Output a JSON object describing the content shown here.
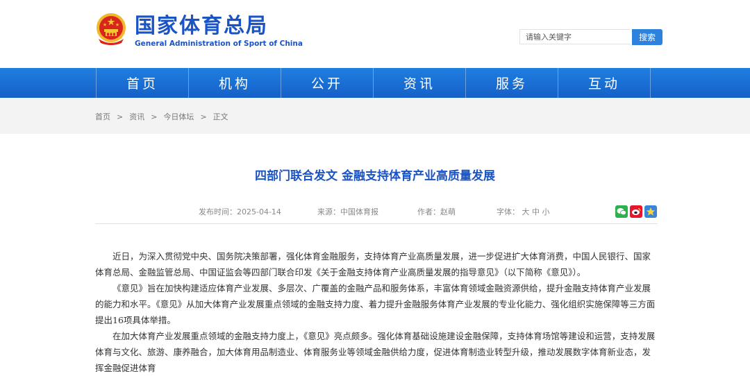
{
  "site": {
    "name_cn": "国家体育总局",
    "name_en": "General Administration of Sport of China"
  },
  "search": {
    "placeholder": "请输入关键字",
    "button": "搜索"
  },
  "nav": [
    "首页",
    "机构",
    "公开",
    "资讯",
    "服务",
    "互动"
  ],
  "breadcrumb": [
    "首页",
    "资讯",
    "今日体坛",
    "正文"
  ],
  "breadcrumb_sep": ">",
  "article": {
    "title": "四部门联合发文 金融支持体育产业高质量发展",
    "meta": {
      "date": "发布时间：2025-04-14",
      "source": "来源：中国体育报",
      "author": "作者：赵萌",
      "fontsize_label": "字体：",
      "fontsize_options": [
        "大",
        "中",
        "小"
      ]
    },
    "share_icons": [
      "wechat-icon",
      "weibo-icon",
      "favorite-icon"
    ],
    "paragraphs": [
      "近日，为深入贯彻党中央、国务院决策部署，强化体育金融服务，支持体育产业高质量发展，进一步促进扩大体育消费，中国人民银行、国家体育总局、金融监管总局、中国证监会等四部门联合印发《关于金融支持体育产业高质量发展的指导意见》（以下简称《意见》）。",
      "《意见》旨在加快构建适应体育产业发展、多层次、广覆盖的金融产品和服务体系，丰富体育领域金融资源供给，提升金融支持体育产业发展的能力和水平。《意见》从加大体育产业发展重点领域的金融支持力度、着力提升金融服务体育产业发展的专业化能力、强化组织实施保障等三方面提出16项具体举措。",
      "在加大体育产业发展重点领域的金融支持力度上，《意见》亮点颇多。强化体育基础设施建设金融保障，支持体育场馆等建设和运营，支持发展体育与文化、旅游、康养融合，加大体育用品制造业、体育服务业等领域金融供给力度，促进体育制造业转型升级，推动发展数字体育新业态，发挥金融促进体育"
    ]
  },
  "colors": {
    "brand_blue": "#1a53c4",
    "nav_blue": "#1b6fd8",
    "search_button": "#2c82dc",
    "emblem_red": "#d8261d",
    "emblem_gold": "#f7c531"
  }
}
